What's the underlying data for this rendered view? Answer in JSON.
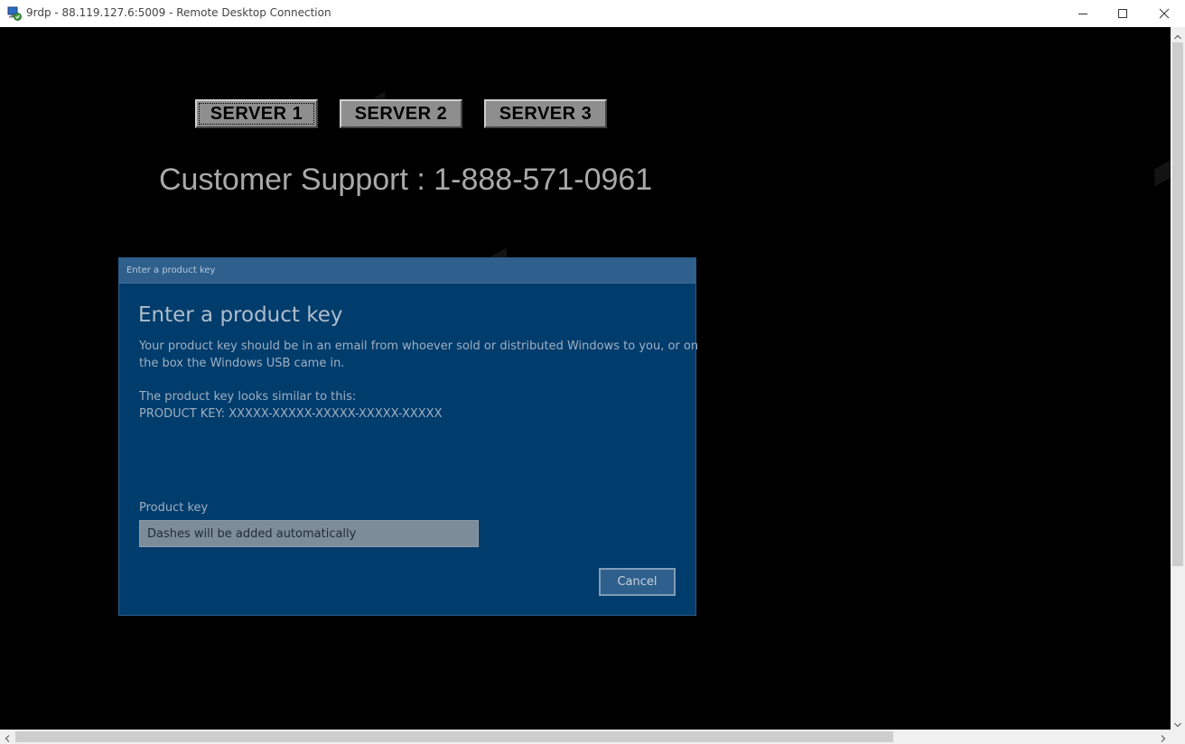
{
  "window": {
    "title": "9rdp - 88.119.127.6:5009 - Remote Desktop Connection",
    "icon": "remote-desktop-icon"
  },
  "controls": {
    "minimize_icon": "minimize-icon",
    "maximize_icon": "maximize-icon",
    "close_icon": "close-icon"
  },
  "servers": [
    {
      "label": "SERVER 1",
      "selected": true
    },
    {
      "label": "SERVER 2",
      "selected": false
    },
    {
      "label": "SERVER 3",
      "selected": false
    }
  ],
  "support": {
    "text": "Customer Support : 1-888-571-0961"
  },
  "dialog": {
    "title": "Enter a product key",
    "heading": "Enter a product key",
    "description_line_1": "Your product key should be in an email from whoever sold or distributed Windows to you, or on",
    "description_line_2": "the box the Windows USB came in.",
    "example_line_1": "The product key looks similar to this:",
    "example_line_2": "PRODUCT KEY: XXXXX-XXXXX-XXXXX-XXXXX-XXXXX",
    "product_key_label": "Product key",
    "product_key_value": "",
    "product_key_placeholder": "Dashes will be added automatically",
    "cancel_label": "Cancel"
  },
  "colors": {
    "dialog_background": "#003c6c",
    "dialog_titlebar": "#2f5f8c",
    "server_button": "#8e8e8e",
    "support_text": "#a9a9a9",
    "desktop_background": "#000000"
  }
}
